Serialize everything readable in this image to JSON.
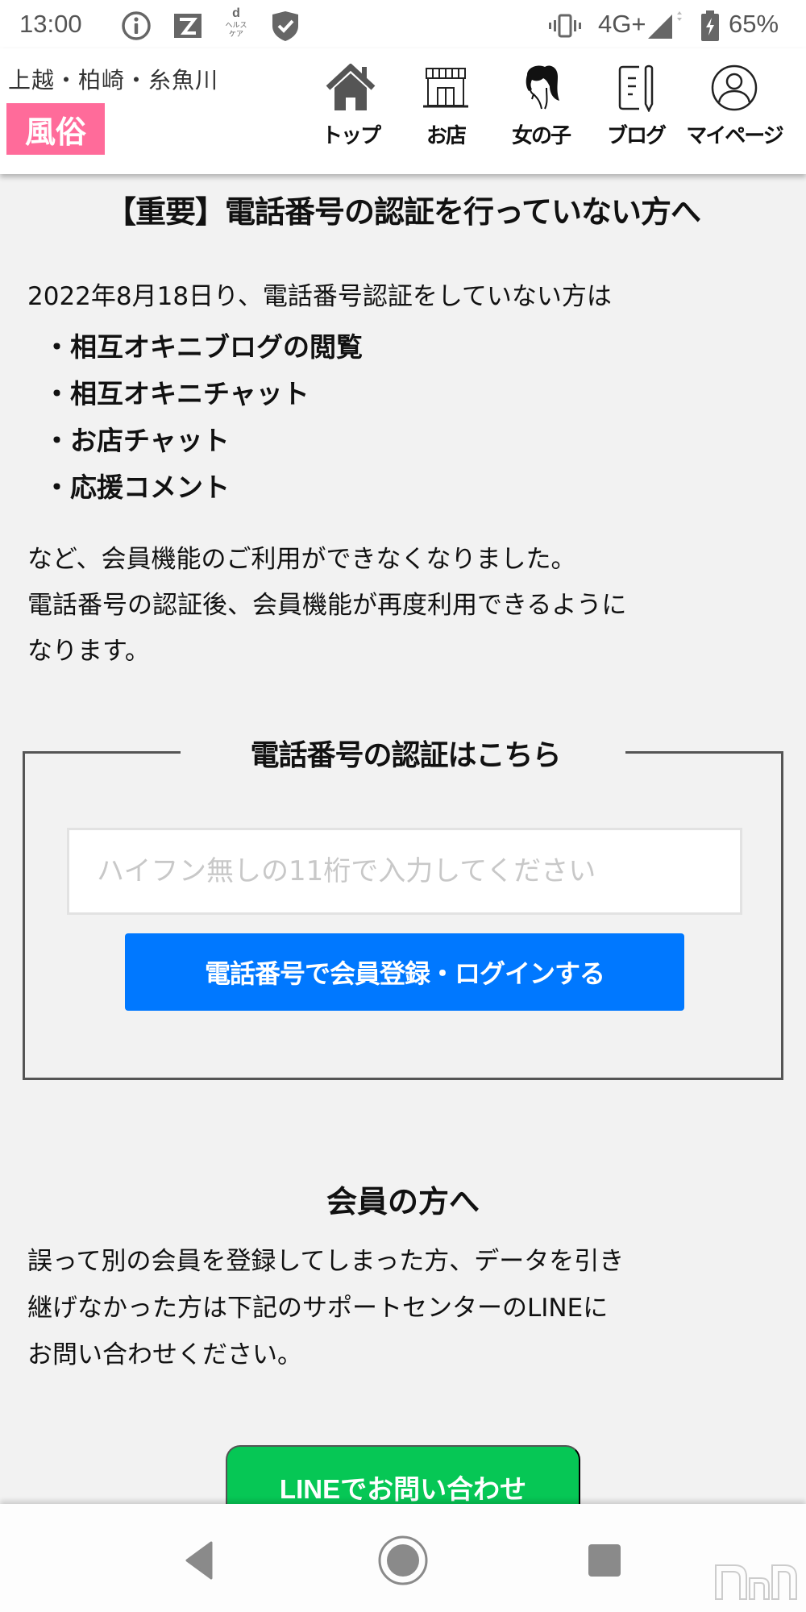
{
  "status_bar": {
    "time": "13:00",
    "network": "4G+",
    "battery": "65%",
    "icons": [
      "info-icon",
      "kz-app-icon",
      "d-healthcare-icon",
      "shield-check-icon",
      "vibrate-icon",
      "signal-icon",
      "battery-charging-icon"
    ]
  },
  "header": {
    "area": "上越・柏崎・糸魚川",
    "category": "風俗",
    "category_color": "#ff6b9a",
    "nav": [
      {
        "label": "トップ",
        "icon": "home-icon"
      },
      {
        "label": "お店",
        "icon": "shop-icon"
      },
      {
        "label": "女の子",
        "icon": "girl-icon"
      },
      {
        "label": "ブログ",
        "icon": "blog-icon"
      },
      {
        "label": "マイページ",
        "icon": "user-icon"
      }
    ]
  },
  "notice": {
    "title": "【重要】電話番号の認証を行っていない方へ",
    "intro": "2022年8月18日り、電話番号認証をしていない方は",
    "features": [
      "相互オキニブログの閲覧",
      "相互オキニチャット",
      "お店チャット",
      "応援コメント"
    ],
    "body_lines": [
      "など、会員機能のご利用ができなくなりました。",
      "電話番号の認証後、会員機能が再度利用できるように",
      "なります。"
    ]
  },
  "verify": {
    "title": "電話番号の認証はこちら",
    "input_placeholder": "ハイフン無しの11桁で入力してください",
    "input_value": "",
    "button_label": "電話番号で会員登録・ログインする",
    "button_color": "#0078ff"
  },
  "member": {
    "title": "会員の方へ",
    "body_lines": [
      "誤って別の会員を登録してしまった方、データを引き",
      "継げなかった方は下記のサポートセンターのLINEに",
      "お問い合わせください。"
    ],
    "line_button_label": "LINEでお問い合わせ",
    "line_color": "#06c755"
  },
  "system_nav": {
    "buttons": [
      "back-icon",
      "home-circle-icon",
      "recents-icon"
    ]
  }
}
